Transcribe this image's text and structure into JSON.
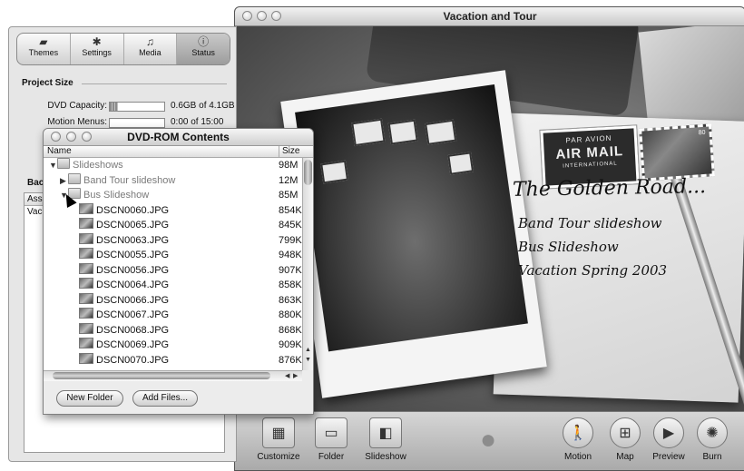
{
  "main_window": {
    "title": "Vacation and Tour",
    "menu": {
      "title": "The Golden Road...",
      "items": [
        "Band Tour slideshow",
        "Bus Slideshow",
        "Vacation Spring 2003"
      ]
    },
    "airmail": {
      "line1": "PAR AVION",
      "line2": "AIR MAIL",
      "line3": "INTERNATIONAL"
    },
    "stamp_value": "80",
    "toolbar": [
      {
        "label": "Customize",
        "icon": "customize-icon"
      },
      {
        "label": "Folder",
        "icon": "folder-icon"
      },
      {
        "label": "Slideshow",
        "icon": "slideshow-icon"
      },
      {
        "label": "Motion",
        "icon": "motion-icon"
      },
      {
        "label": "Map",
        "icon": "map-icon"
      },
      {
        "label": "Preview",
        "icon": "play-icon"
      },
      {
        "label": "Burn",
        "icon": "burn-icon"
      }
    ]
  },
  "drawer": {
    "tabs": [
      {
        "label": "Themes",
        "icon": "themes-icon"
      },
      {
        "label": "Settings",
        "icon": "gear-icon"
      },
      {
        "label": "Media",
        "icon": "media-icon"
      },
      {
        "label": "Status",
        "icon": "info-icon",
        "active": true
      }
    ],
    "project_size_heading": "Project Size",
    "dvd_capacity": {
      "label": "DVD Capacity:",
      "value": "0.6GB of 4.1GB",
      "fraction": 0.15
    },
    "motion_menus": {
      "label": "Motion Menus:",
      "value": "0:00 of 15:00",
      "fraction": 0.0
    },
    "background_label": "Bac",
    "list_rows": [
      "Ass",
      "Vac"
    ]
  },
  "dvd_window": {
    "title": "DVD-ROM Contents",
    "columns": {
      "name": "Name",
      "size": "Size"
    },
    "rows": [
      {
        "indent": 0,
        "tri": "▼",
        "icon": "folder",
        "name": "Slideshows",
        "size": "98M"
      },
      {
        "indent": 1,
        "tri": "▶",
        "icon": "folder",
        "name": "Band Tour slideshow",
        "size": "12M"
      },
      {
        "indent": 1,
        "tri": "▼",
        "icon": "folder",
        "name": "Bus Slideshow",
        "size": "85M"
      },
      {
        "indent": 2,
        "tri": "",
        "icon": "image",
        "name": "DSCN0060.JPG",
        "size": "854K"
      },
      {
        "indent": 2,
        "tri": "",
        "icon": "image",
        "name": "DSCN0065.JPG",
        "size": "845K"
      },
      {
        "indent": 2,
        "tri": "",
        "icon": "image",
        "name": "DSCN0063.JPG",
        "size": "799K"
      },
      {
        "indent": 2,
        "tri": "",
        "icon": "image",
        "name": "DSCN0055.JPG",
        "size": "948K"
      },
      {
        "indent": 2,
        "tri": "",
        "icon": "image",
        "name": "DSCN0056.JPG",
        "size": "907K"
      },
      {
        "indent": 2,
        "tri": "",
        "icon": "image",
        "name": "DSCN0064.JPG",
        "size": "858K"
      },
      {
        "indent": 2,
        "tri": "",
        "icon": "image",
        "name": "DSCN0066.JPG",
        "size": "863K"
      },
      {
        "indent": 2,
        "tri": "",
        "icon": "image",
        "name": "DSCN0067.JPG",
        "size": "880K"
      },
      {
        "indent": 2,
        "tri": "",
        "icon": "image",
        "name": "DSCN0068.JPG",
        "size": "868K"
      },
      {
        "indent": 2,
        "tri": "",
        "icon": "image",
        "name": "DSCN0069.JPG",
        "size": "909K"
      },
      {
        "indent": 2,
        "tri": "",
        "icon": "image",
        "name": "DSCN0070.JPG",
        "size": "876K"
      }
    ],
    "buttons": {
      "new_folder": "New Folder",
      "add_files": "Add Files..."
    }
  }
}
